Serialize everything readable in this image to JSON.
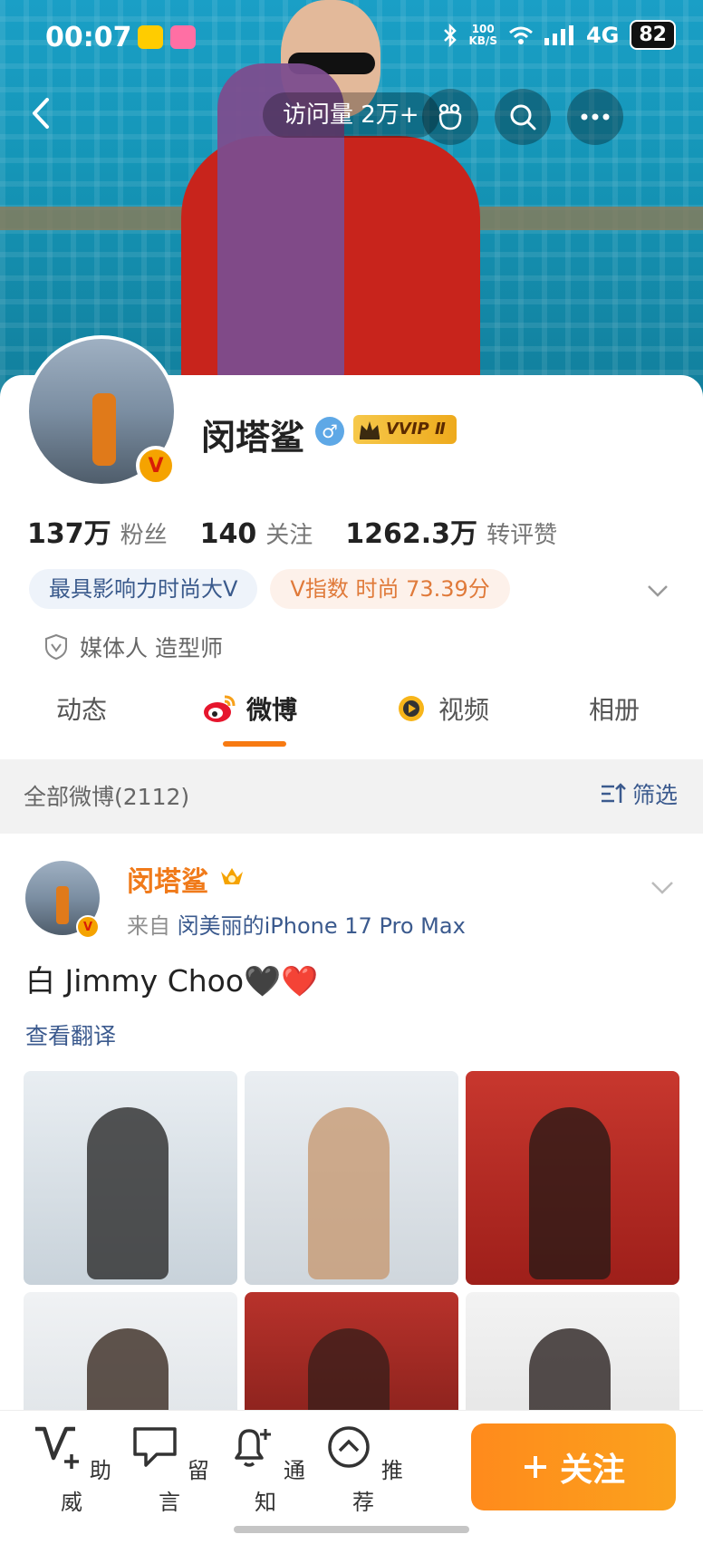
{
  "status_bar": {
    "time": "00:07",
    "speed_value": "100",
    "speed_unit": "KB/S",
    "network": "4G",
    "battery": "82"
  },
  "top_nav": {
    "visits_label": "访问量 2万+"
  },
  "profile": {
    "name": "闵塔鲨",
    "vip_label": "VVIP Ⅱ",
    "verified_mark": "V",
    "stats": [
      {
        "value": "137万",
        "label": "粉丝"
      },
      {
        "value": "140",
        "label": "关注"
      },
      {
        "value": "1262.3万",
        "label": "转评赞"
      }
    ],
    "tags": [
      "最具影响力时尚大V",
      "V指数 时尚 73.39分"
    ],
    "identity": "媒体人 造型师"
  },
  "tabs": [
    {
      "label": "动态"
    },
    {
      "label": "微博"
    },
    {
      "label": "视频"
    },
    {
      "label": "相册"
    }
  ],
  "filter_bar": {
    "count_label": "全部微博(2112)",
    "filter_label": "筛选"
  },
  "post": {
    "author": "闵塔鲨",
    "source_prefix": "来自",
    "device": "闵美丽的iPhone 17 Pro Max",
    "text": "白 Jimmy Choo🖤❤️",
    "translate_label": "查看翻译",
    "images": [
      {
        "colors": [
          "#e9eef2",
          "#c8d2da"
        ],
        "figure": "#2a2a2a"
      },
      {
        "colors": [
          "#eaeef2",
          "#cfd6dc"
        ],
        "figure": "#c79a73"
      },
      {
        "colors": [
          "#c8372e",
          "#9e1f1a"
        ],
        "figure": "#2a1a16"
      },
      {
        "colors": [
          "#f0f2f4",
          "#d7dde2"
        ],
        "figure": "#3a2a22"
      },
      {
        "colors": [
          "#b8322b",
          "#6e1814"
        ],
        "figure": "#3a1e1a"
      },
      {
        "colors": [
          "#f3f3f3",
          "#dedede"
        ],
        "figure": "#2a2220"
      }
    ]
  },
  "bottom_bar": {
    "items": [
      {
        "label": "助威",
        "icon": "v-plus-icon"
      },
      {
        "label": "留言",
        "icon": "message-icon"
      },
      {
        "label": "通知",
        "icon": "bell-plus-icon"
      },
      {
        "label": "推荐",
        "icon": "chevron-up-circle-icon"
      }
    ],
    "follow_label": "关注"
  },
  "colors": {
    "accent": "#f77a12",
    "link": "#3b5a8e",
    "follow_button": "#ff8a1c"
  }
}
